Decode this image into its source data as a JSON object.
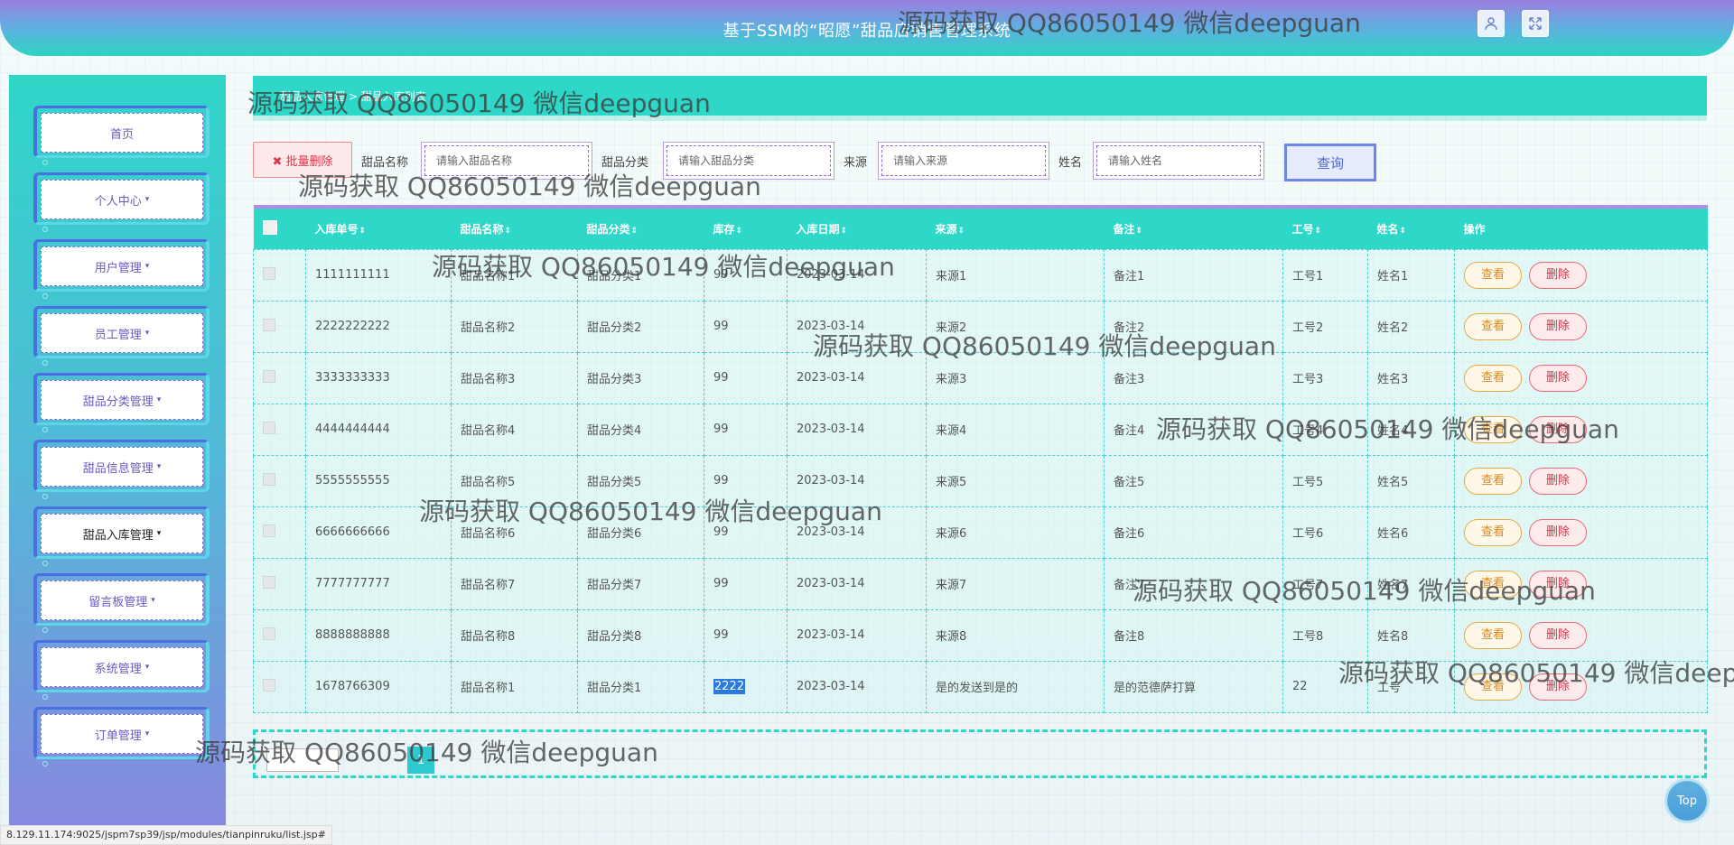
{
  "header": {
    "title": "基于SSM的“昭愿”甜品店销售管理系统",
    "user_icon": "user-icon",
    "fullscreen_icon": "fullscreen-icon"
  },
  "sidebar": {
    "items": [
      {
        "label": "首页",
        "has_caret": false
      },
      {
        "label": "个人中心",
        "has_caret": true
      },
      {
        "label": "用户管理",
        "has_caret": true
      },
      {
        "label": "员工管理",
        "has_caret": true
      },
      {
        "label": "甜品分类管理",
        "has_caret": true
      },
      {
        "label": "甜品信息管理",
        "has_caret": true
      },
      {
        "label": "甜品入库管理",
        "has_caret": true
      },
      {
        "label": "留言板管理",
        "has_caret": true
      },
      {
        "label": "系统管理",
        "has_caret": true
      },
      {
        "label": "订单管理",
        "has_caret": true
      }
    ],
    "caret": "▾"
  },
  "breadcrumb": {
    "text": "甜品入库管理 > 甜品入库列表"
  },
  "search": {
    "delete_button": "✖ 批量删除",
    "fields": [
      {
        "label": "甜品名称",
        "placeholder": "请输入甜品名称"
      },
      {
        "label": "甜品分类",
        "placeholder": "请输入甜品分类"
      },
      {
        "label": "来源",
        "placeholder": "请输入来源"
      },
      {
        "label": "姓名",
        "placeholder": "请输入姓名"
      }
    ],
    "query_button": "查询"
  },
  "table": {
    "columns": [
      "入库单号",
      "甜品名称",
      "甜品分类",
      "库存",
      "入库日期",
      "来源",
      "备注",
      "工号",
      "姓名",
      "操作"
    ],
    "sort_glyph": "⇕",
    "view_label": "查看",
    "delete_label": "删除",
    "rows": [
      [
        "1111111111",
        "甜品名称1",
        "甜品分类1",
        "99",
        "2023-03-14",
        "来源1",
        "备注1",
        "工号1",
        "姓名1"
      ],
      [
        "2222222222",
        "甜品名称2",
        "甜品分类2",
        "99",
        "2023-03-14",
        "来源2",
        "备注2",
        "工号2",
        "姓名2"
      ],
      [
        "3333333333",
        "甜品名称3",
        "甜品分类3",
        "99",
        "2023-03-14",
        "来源3",
        "备注3",
        "工号3",
        "姓名3"
      ],
      [
        "4444444444",
        "甜品名称4",
        "甜品分类4",
        "99",
        "2023-03-14",
        "来源4",
        "备注4",
        "工号4",
        "姓名4"
      ],
      [
        "5555555555",
        "甜品名称5",
        "甜品分类5",
        "99",
        "2023-03-14",
        "来源5",
        "备注5",
        "工号5",
        "姓名5"
      ],
      [
        "6666666666",
        "甜品名称6",
        "甜品分类6",
        "99",
        "2023-03-14",
        "来源6",
        "备注6",
        "工号6",
        "姓名6"
      ],
      [
        "7777777777",
        "甜品名称7",
        "甜品分类7",
        "99",
        "2023-03-14",
        "来源7",
        "备注7",
        "工号7",
        "姓名7"
      ],
      [
        "8888888888",
        "甜品名称8",
        "甜品分类8",
        "99",
        "2023-03-14",
        "来源8",
        "备注8",
        "工号8",
        "姓名8"
      ],
      [
        "1678766309",
        "甜品名称1",
        "甜品分类1",
        "2222",
        "2023-03-14",
        "是的发送到是的",
        "是的范德萨打算",
        "22",
        "工号"
      ]
    ]
  },
  "pager": {
    "page_label": "1"
  },
  "top_button": "Top",
  "status_url": "8.129.11.174:9025/jspm7sp39/jsp/modules/tianpinruku/list.jsp#",
  "watermark": "源码获取 QQ86050149 微信deepguan",
  "colors": {
    "primary": "#2dd8c8",
    "accent": "#8a6ad0",
    "danger": "#e0344a",
    "warning": "#d88a20"
  }
}
